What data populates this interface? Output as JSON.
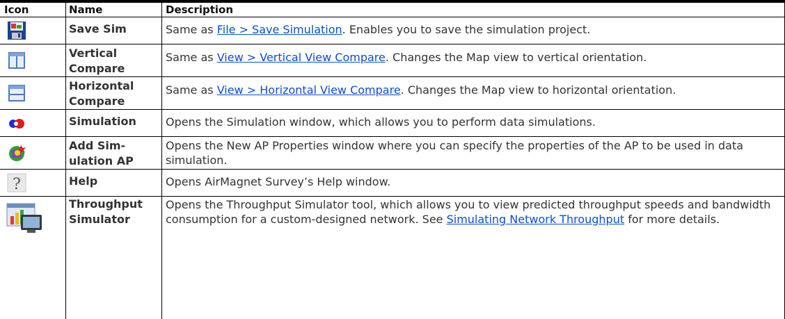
{
  "header": {
    "icon": "Icon",
    "name": "Name",
    "description": "Description"
  },
  "rows": [
    {
      "icon": "save-sim-icon",
      "name": "Save Sim",
      "desc_pre": "Same as ",
      "link": "File > Save Simulation",
      "desc_post": ". Enables you to save the simulation project."
    },
    {
      "icon": "vertical-compare-icon",
      "name": "Vertical Compare",
      "desc_pre": "Same as ",
      "link": "View > Vertical View Compare",
      "desc_post": ". Changes the Map view to vertical orientation."
    },
    {
      "icon": "horizontal-compare-icon",
      "name": "Horizontal Compare",
      "desc_pre": "Same as ",
      "link": "View > Horizontal View Compare",
      "desc_post": ". Changes the Map view to horizontal orientation."
    },
    {
      "icon": "simulation-icon",
      "name": "Simulation",
      "desc": "Opens the Simulation window, which allows you to perform data simulations."
    },
    {
      "icon": "add-simulation-ap-icon",
      "name": "Add Sim-ulation AP",
      "desc": "Opens the New AP Properties window where you can specify the properties of the AP to be used in data simulation."
    },
    {
      "icon": "help-icon",
      "name": "Help",
      "desc": "Opens AirMagnet Survey’s Help window."
    },
    {
      "icon": "throughput-simulator-icon",
      "name": "Throughput Simulator",
      "desc_pre": "Opens the Throughput Simulator tool, which allows you to view predicted throughput speeds and bandwidth consumption for a custom-designed network. See ",
      "link": "Simulating Network Throughput",
      "desc_post": " for more details."
    }
  ]
}
